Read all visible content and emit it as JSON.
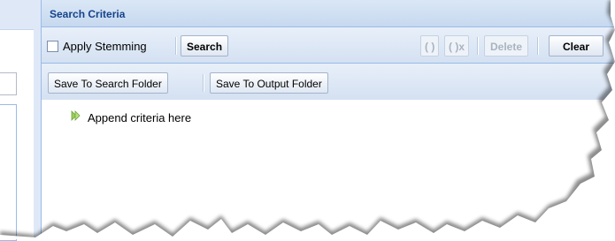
{
  "panel": {
    "title": "Search Criteria"
  },
  "toolbar1": {
    "stemming_label": "Apply Stemming",
    "search_label": "Search",
    "paren_label": "( )",
    "paren_x_label": "( )x",
    "delete_label": "Delete",
    "clear_label": "Clear"
  },
  "toolbar2": {
    "save_search_label": "Save To Search Folder",
    "save_output_label": "Save To Output Folder"
  },
  "tree": {
    "placeholder": "Append criteria here"
  },
  "icons": {
    "append": "green-double-arrow-icon"
  }
}
